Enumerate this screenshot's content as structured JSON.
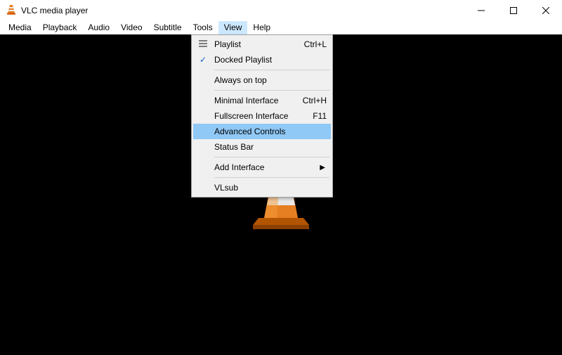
{
  "window": {
    "title": "VLC media player"
  },
  "menubar": {
    "items": [
      {
        "label": "Media"
      },
      {
        "label": "Playback"
      },
      {
        "label": "Audio"
      },
      {
        "label": "Video"
      },
      {
        "label": "Subtitle"
      },
      {
        "label": "Tools"
      },
      {
        "label": "View"
      },
      {
        "label": "Help"
      }
    ],
    "open_index": 6
  },
  "view_menu": {
    "items": [
      {
        "label": "Playlist",
        "shortcut": "Ctrl+L",
        "icon": "playlist"
      },
      {
        "label": "Docked Playlist",
        "checked": true
      },
      {
        "separator": true
      },
      {
        "label": "Always on top"
      },
      {
        "separator": true
      },
      {
        "label": "Minimal Interface",
        "shortcut": "Ctrl+H"
      },
      {
        "label": "Fullscreen Interface",
        "shortcut": "F11"
      },
      {
        "label": "Advanced Controls",
        "highlighted": true
      },
      {
        "label": "Status Bar"
      },
      {
        "separator": true
      },
      {
        "label": "Add Interface",
        "submenu": true
      },
      {
        "separator": true
      },
      {
        "label": "VLsub"
      }
    ]
  }
}
